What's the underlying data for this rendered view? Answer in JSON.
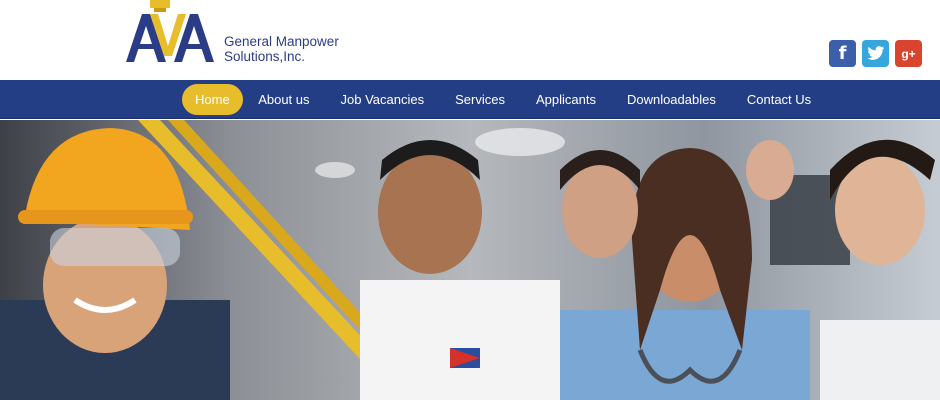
{
  "header": {
    "logo_monogram": "AVA",
    "company_name_line1": "General Manpower",
    "company_name_line2": "Solutions,Inc."
  },
  "social": [
    {
      "name": "facebook",
      "glyph": "f",
      "color": "#3b5fa8"
    },
    {
      "name": "twitter",
      "glyph": "t",
      "color": "#37a6dc"
    },
    {
      "name": "google-plus",
      "glyph": "g+",
      "color": "#d9442f"
    }
  ],
  "nav": {
    "items": [
      {
        "label": "Home",
        "active": true
      },
      {
        "label": "About us",
        "active": false
      },
      {
        "label": "Job Vacancies",
        "active": false
      },
      {
        "label": "Services",
        "active": false
      },
      {
        "label": "Applicants",
        "active": false
      },
      {
        "label": "Downloadables",
        "active": false
      },
      {
        "label": "Contact Us",
        "active": false
      }
    ]
  },
  "colors": {
    "brand_blue": "#243e86",
    "accent_gold": "#e7bd2b",
    "text_blue": "#2b3c87"
  },
  "hero": {
    "description": "Banner photo collage of workers: construction worker, chef, nurse, call center agents"
  }
}
